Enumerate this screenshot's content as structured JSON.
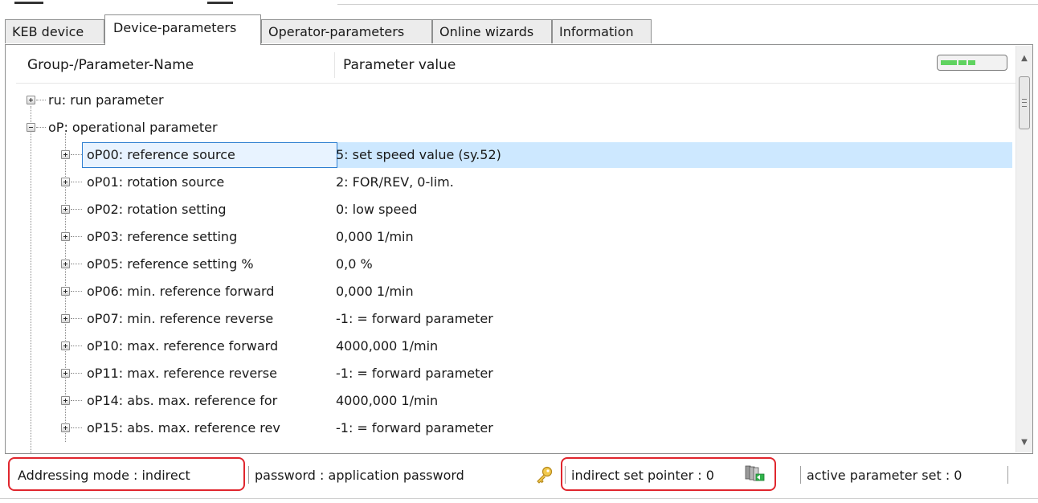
{
  "tabs": [
    "KEB device",
    "Device-parameters",
    "Operator-parameters",
    "Online wizards",
    "Information"
  ],
  "active_tab_index": 1,
  "columns": {
    "name": "Group-/Parameter-Name",
    "value": "Parameter value"
  },
  "progress_level": 0.55,
  "tree": {
    "groups": [
      {
        "label": "ru: run parameter",
        "expanded": false
      },
      {
        "label": "oP: operational parameter",
        "expanded": true
      }
    ],
    "params": [
      {
        "name": "oP00: reference source",
        "value": "5: set speed value (sy.52)",
        "selected": true
      },
      {
        "name": "oP01: rotation source",
        "value": "2: FOR/REV, 0-lim."
      },
      {
        "name": "oP02: rotation setting",
        "value": "0: low speed"
      },
      {
        "name": "oP03: reference setting",
        "value": "0,000 1/min"
      },
      {
        "name": "oP05: reference setting %",
        "value": "0,0 %"
      },
      {
        "name": "oP06: min. reference forward",
        "value": "0,000 1/min"
      },
      {
        "name": "oP07: min. reference reverse",
        "value": "-1: = forward parameter"
      },
      {
        "name": "oP10: max. reference forward",
        "value": "4000,000 1/min"
      },
      {
        "name": "oP11: max. reference reverse",
        "value": "-1: = forward parameter"
      },
      {
        "name": "oP14: abs. max. reference for",
        "value": "4000,000 1/min"
      },
      {
        "name": "oP15: abs. max. reference rev",
        "value": "-1: = forward parameter"
      }
    ]
  },
  "status": {
    "addressing": "Addressing mode  : indirect",
    "password": "password : application password",
    "pointer": "indirect set pointer  : 0",
    "active_set": "active parameter set  : 0"
  },
  "colors": {
    "selection": "#cde8ff",
    "selection_border": "#2f7fd1",
    "highlight": "#e0262e",
    "progress_fill": "#5fd35f"
  },
  "icons": {
    "password": "key-icon",
    "pointer": "parameter-set-pointer-icon"
  }
}
